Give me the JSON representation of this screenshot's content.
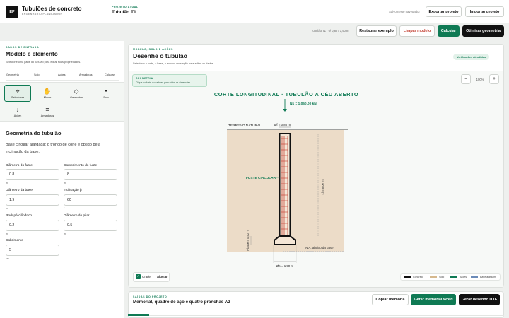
{
  "header": {
    "logo": "EP",
    "title": "Tubulões de concreto",
    "subtitle": "ENGENHARIO PLANEJADOR",
    "project_eyebrow": "PROJETO ATUAL",
    "project_name": "Tubulão T1",
    "status": "Salvo neste navegador",
    "export_label": "Exportar projeto",
    "import_label": "Importar projeto"
  },
  "toolbar": {
    "summary": "Tubulão T1 · Ø 0,80 / 1,90 m",
    "restore_label": "Restaurar exemplo",
    "clear_label": "Limpar modelo",
    "calc_label": "Calcular",
    "optimize_label": "Otimizar geometria"
  },
  "sidebar": {
    "eyebrow": "DADOS DE ENTRADA",
    "title": "Modelo e elemento",
    "desc": "Selecione uma parte do tubulão para editar suas propriedades.",
    "tabs": [
      "Geometria",
      "Solo",
      "Ações",
      "Armaduras",
      "Calcular"
    ],
    "tools": [
      {
        "label": "Selecionar",
        "icon": "⌖"
      },
      {
        "label": "Mover",
        "icon": "✋"
      },
      {
        "label": "Geometria",
        "icon": "◇"
      },
      {
        "label": "Solo",
        "icon": "◓"
      },
      {
        "label": "Ações",
        "icon": "↓"
      },
      {
        "label": "Armaduras",
        "icon": "≡"
      }
    ],
    "section_title": "Geometria do tubulão",
    "section_desc": "Base circular alargada; o tronco de cone é obtido pela inclinação da base.",
    "fields": [
      {
        "label": "Diâmetro do fuste",
        "value": "0.8",
        "unit": "m"
      },
      {
        "label": "Comprimento do fuste",
        "value": "8",
        "unit": "m"
      },
      {
        "label": "Diâmetro da base",
        "value": "1.9",
        "unit": "m"
      },
      {
        "label": "Inclinação β",
        "value": "60",
        "unit": "°"
      },
      {
        "label": "Rodapé cilíndrico",
        "value": "0.2",
        "unit": "m"
      },
      {
        "label": "Diâmetro do pilar",
        "value": "0.5",
        "unit": "m"
      },
      {
        "label": "Cobrimento",
        "value": "5",
        "unit": "cm"
      }
    ]
  },
  "main": {
    "eyebrow": "MODELO, SOLO E AÇÕES",
    "title": "Desenhe o tubulão",
    "desc": "Selecione o fuste, a base, o solo ou uma ação para editar os dados.",
    "badge": "Verificações atendidas",
    "info_title": "GEOMETRIA",
    "info_desc": "Clique no fuste ou na base para editar as dimensões.",
    "zoom_minus": "−",
    "zoom": "100%",
    "zoom_plus": "+",
    "grid_label": "Grade",
    "fit_label": "Ajustar",
    "legend": [
      "Concreto",
      "Solo",
      "Ações",
      "Base/alargam"
    ]
  },
  "drawing": {
    "title": "CORTE LONGITUDINAL · TUBULÃO A CÉU ABERTO",
    "load": "Nk = 1.050,00 kN",
    "ground": "TERRENO NATURAL",
    "shaft_dim": "Øf = 0,80 m",
    "shaft_label": "FUSTE CIRCULAR",
    "length": "Lf = 8,00 m",
    "base_height": "Hbase = 0,52 m",
    "water": "N.A. abaixo da base",
    "base_dim": "Øb = 1,90 m"
  },
  "output": {
    "eyebrow": "SAÍDAS DO PROJETO",
    "title": "Memorial, quadro de aço e quatro pranchas A2",
    "copy_label": "Copiar memória",
    "word_label": "Gerar memorial Word",
    "dxf_label": "Gerar desenho DXF"
  },
  "colors": {
    "accent": "#0f7a54",
    "soil": "#ecdcc8",
    "concrete": "#111111",
    "rebar": "#c0392b"
  }
}
